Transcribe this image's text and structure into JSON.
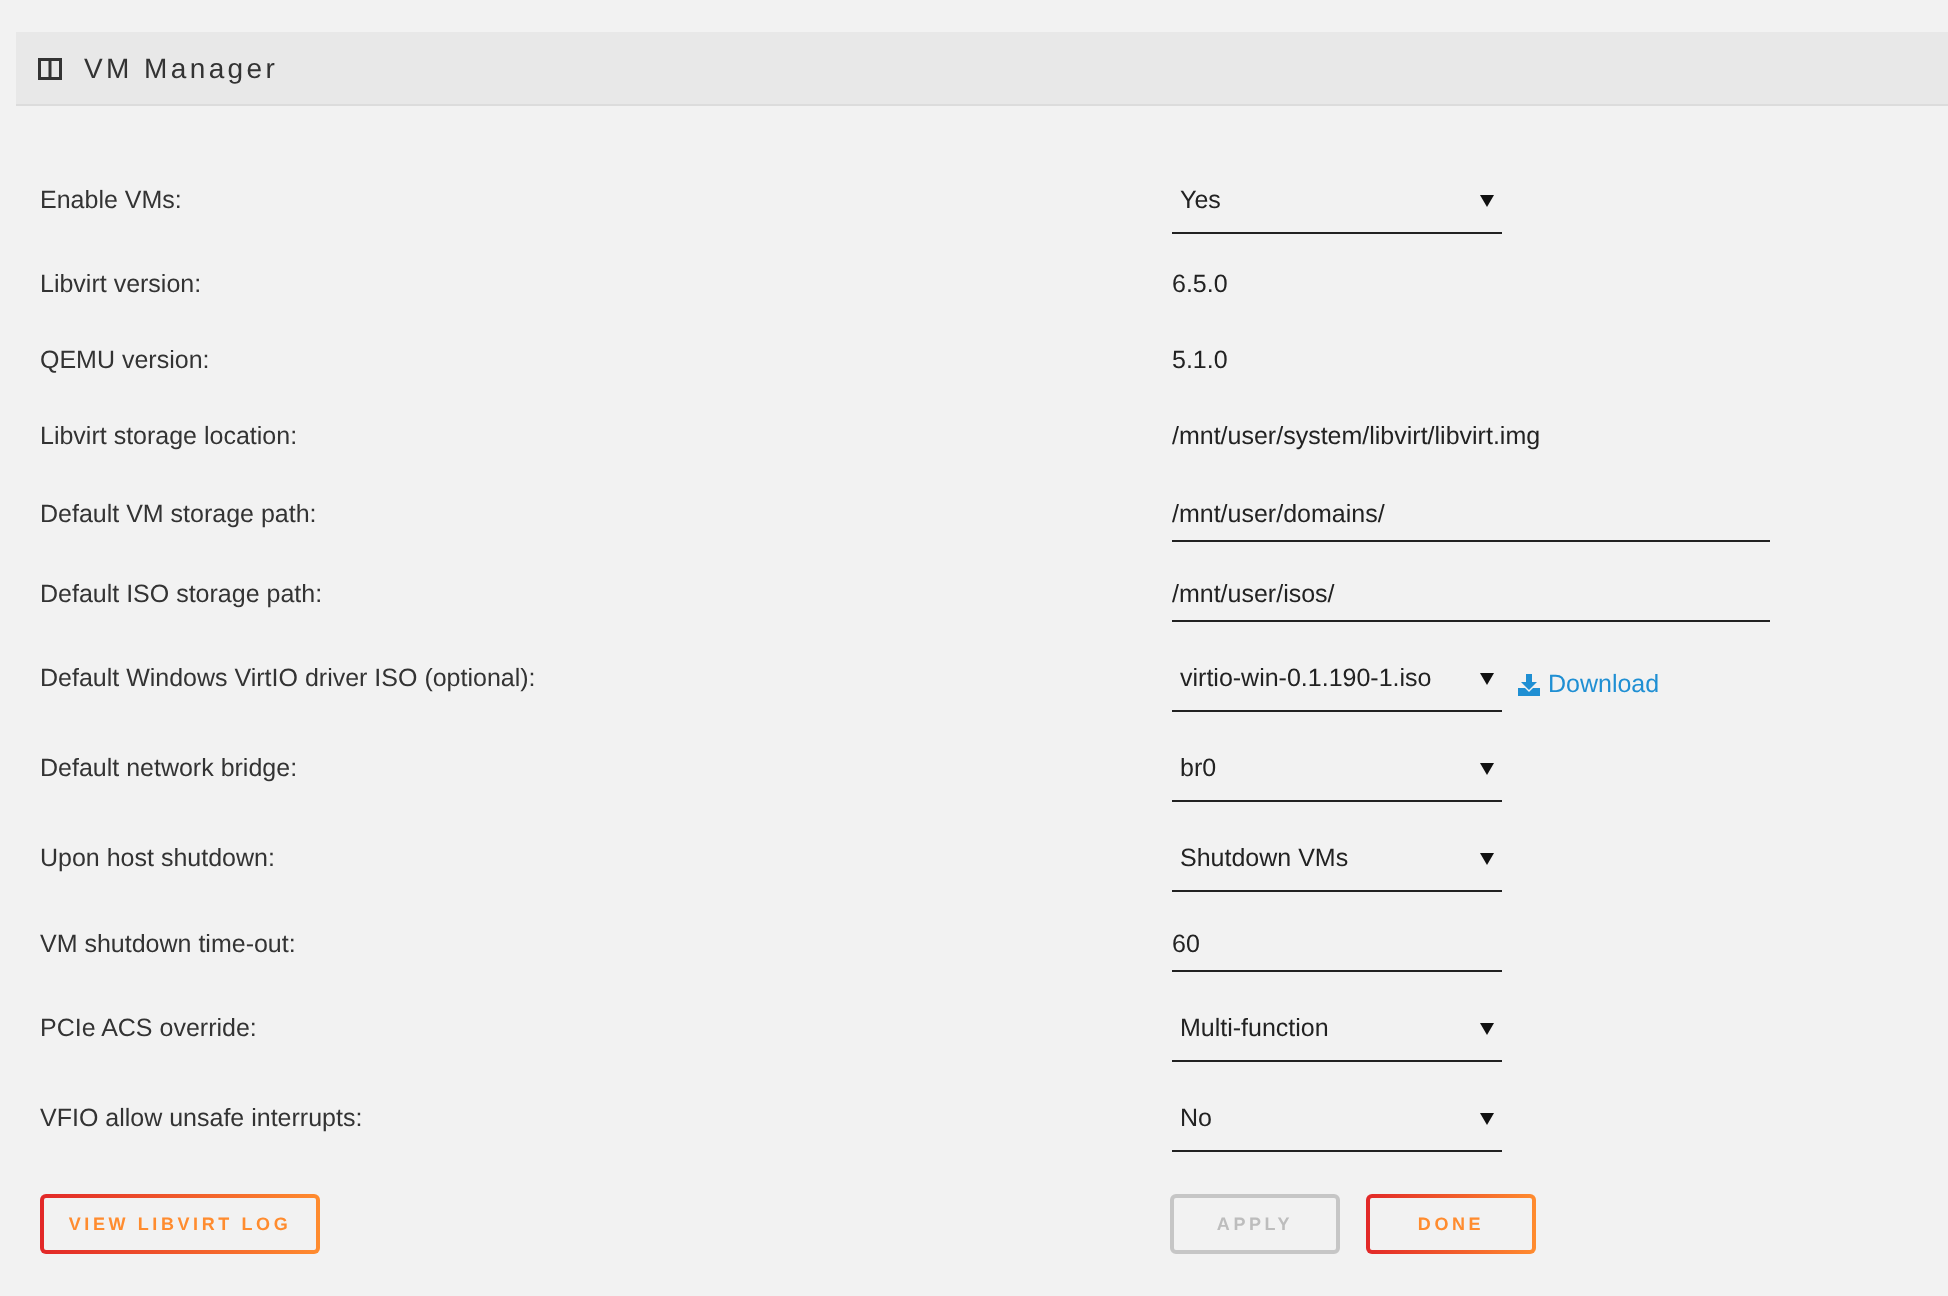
{
  "header": {
    "title": "VM Manager"
  },
  "settings": [
    {
      "label": "Enable VMs:",
      "kind": "select",
      "value": "Yes"
    },
    {
      "label": "Libvirt version:",
      "kind": "readonly",
      "value": "6.5.0"
    },
    {
      "label": "QEMU version:",
      "kind": "readonly",
      "value": "5.1.0"
    },
    {
      "label": "Libvirt storage location:",
      "kind": "readonly",
      "value": "/mnt/user/system/libvirt/libvirt.img"
    },
    {
      "label": "Default VM storage path:",
      "kind": "textfield",
      "value": "/mnt/user/domains/"
    },
    {
      "label": "Default ISO storage path:",
      "kind": "textfield",
      "value": "/mnt/user/isos/"
    },
    {
      "label": "Default Windows VirtIO driver ISO (optional):",
      "kind": "select",
      "value": "virtio-win-0.1.190-1.iso",
      "link": "Download"
    },
    {
      "label": "Default network bridge:",
      "kind": "select",
      "value": "br0"
    },
    {
      "label": "Upon host shutdown:",
      "kind": "select",
      "value": "Shutdown VMs"
    },
    {
      "label": "VM shutdown time-out:",
      "kind": "numberfield",
      "value": "60"
    },
    {
      "label": "PCIe ACS override:",
      "kind": "select",
      "value": "Multi-function"
    },
    {
      "label": "VFIO allow unsafe interrupts:",
      "kind": "select",
      "value": "No"
    }
  ],
  "footer_left": [
    {
      "label": "VIEW LIBVIRT LOG",
      "disabled": false
    }
  ],
  "footer_right": [
    {
      "label": "APPLY",
      "disabled": true
    },
    {
      "label": "DONE",
      "disabled": false
    }
  ]
}
